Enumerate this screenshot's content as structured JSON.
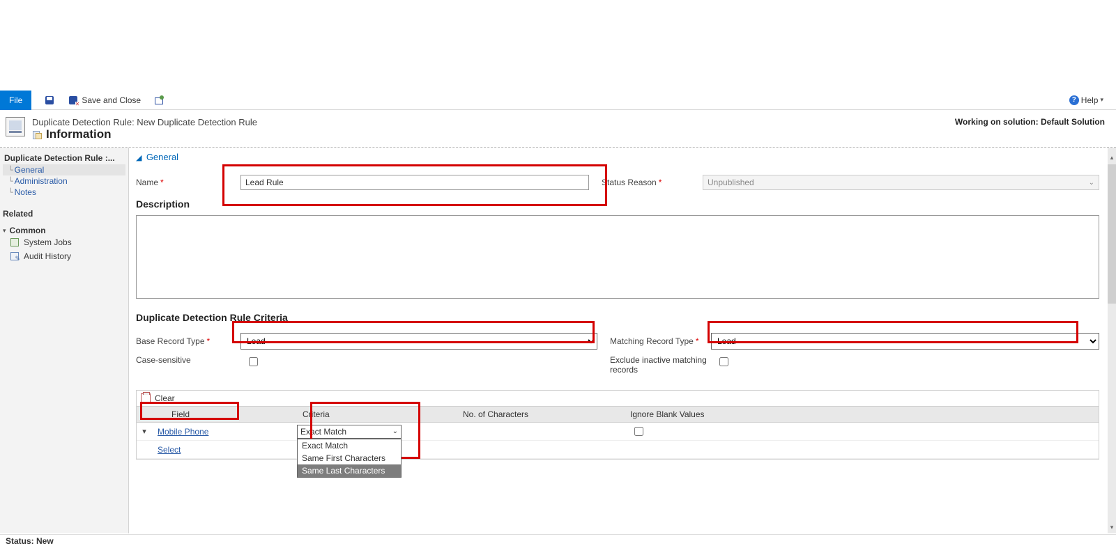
{
  "toolbar": {
    "file_label": "File",
    "save_and_close_label": "Save and Close",
    "help_label": "Help"
  },
  "entity": {
    "breadcrumb": "Duplicate Detection Rule: New Duplicate Detection Rule",
    "title": "Information",
    "working_on": "Working on solution: Default Solution"
  },
  "sidebar": {
    "heading": "Duplicate Detection Rule :...",
    "items": [
      {
        "label": "General"
      },
      {
        "label": "Administration"
      },
      {
        "label": "Notes"
      }
    ],
    "related_label": "Related",
    "common_label": "Common",
    "common_items": [
      {
        "label": "System Jobs"
      },
      {
        "label": "Audit History"
      }
    ]
  },
  "form": {
    "section_general": "General",
    "name_label": "Name",
    "name_value": "Lead Rule",
    "status_reason_label": "Status Reason",
    "status_reason_value": "Unpublished",
    "description_label": "Description",
    "description_value": "",
    "criteria_header": "Duplicate Detection Rule Criteria",
    "base_type_label": "Base Record Type",
    "base_type_value": "Lead",
    "matching_type_label": "Matching Record Type",
    "matching_type_value": "Lead",
    "case_sensitive_label": "Case-sensitive",
    "exclude_inactive_label": "Exclude inactive matching records"
  },
  "conditions": {
    "clear_label": "Clear",
    "columns": {
      "field": "Field",
      "criteria": "Criteria",
      "chars": "No. of Characters",
      "blank": "Ignore Blank Values"
    },
    "rows": [
      {
        "field": "Mobile Phone",
        "criteria": "Exact Match"
      }
    ],
    "select_placeholder": "Select",
    "criteria_options": [
      "Exact Match",
      "Same First Characters",
      "Same Last Characters"
    ],
    "criteria_highlight_index": 2
  },
  "statusbar": {
    "text": "Status: New"
  }
}
